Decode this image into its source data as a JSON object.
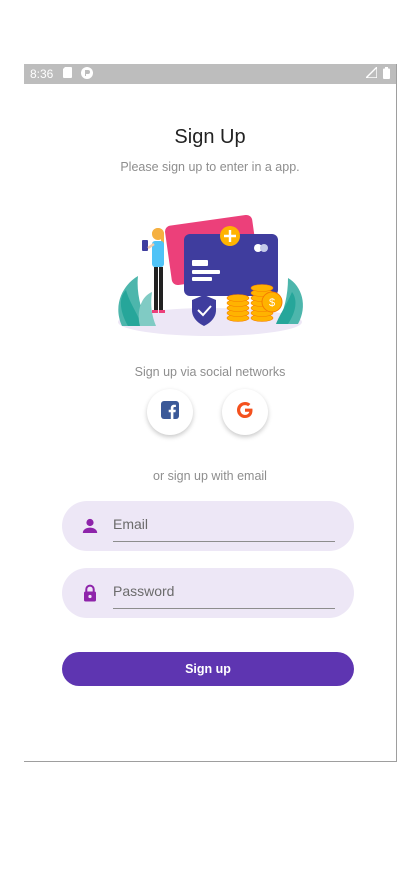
{
  "status_bar": {
    "time": "8:36",
    "left_icons": [
      "sd-card-icon",
      "notification-app-icon"
    ],
    "right_icons": [
      "signal-icon",
      "battery-icon"
    ]
  },
  "header": {
    "title": "Sign Up",
    "subtitle": "Please sign up to enter in a app."
  },
  "social": {
    "label": "Sign up via social networks",
    "buttons": [
      {
        "name": "facebook",
        "icon": "facebook-icon",
        "color": "#3b5998"
      },
      {
        "name": "google",
        "icon": "google-icon",
        "color": "#f4511e"
      }
    ]
  },
  "email_section": {
    "label": "or sign up with email"
  },
  "form": {
    "email": {
      "placeholder": "Email",
      "value": "",
      "icon": "person-icon"
    },
    "password": {
      "placeholder": "Password",
      "value": "",
      "icon": "lock-icon"
    },
    "submit_label": "Sign up"
  },
  "colors": {
    "accent": "#5e35b1",
    "field_background": "#ede7f6",
    "icon_purple": "#8e24aa"
  }
}
